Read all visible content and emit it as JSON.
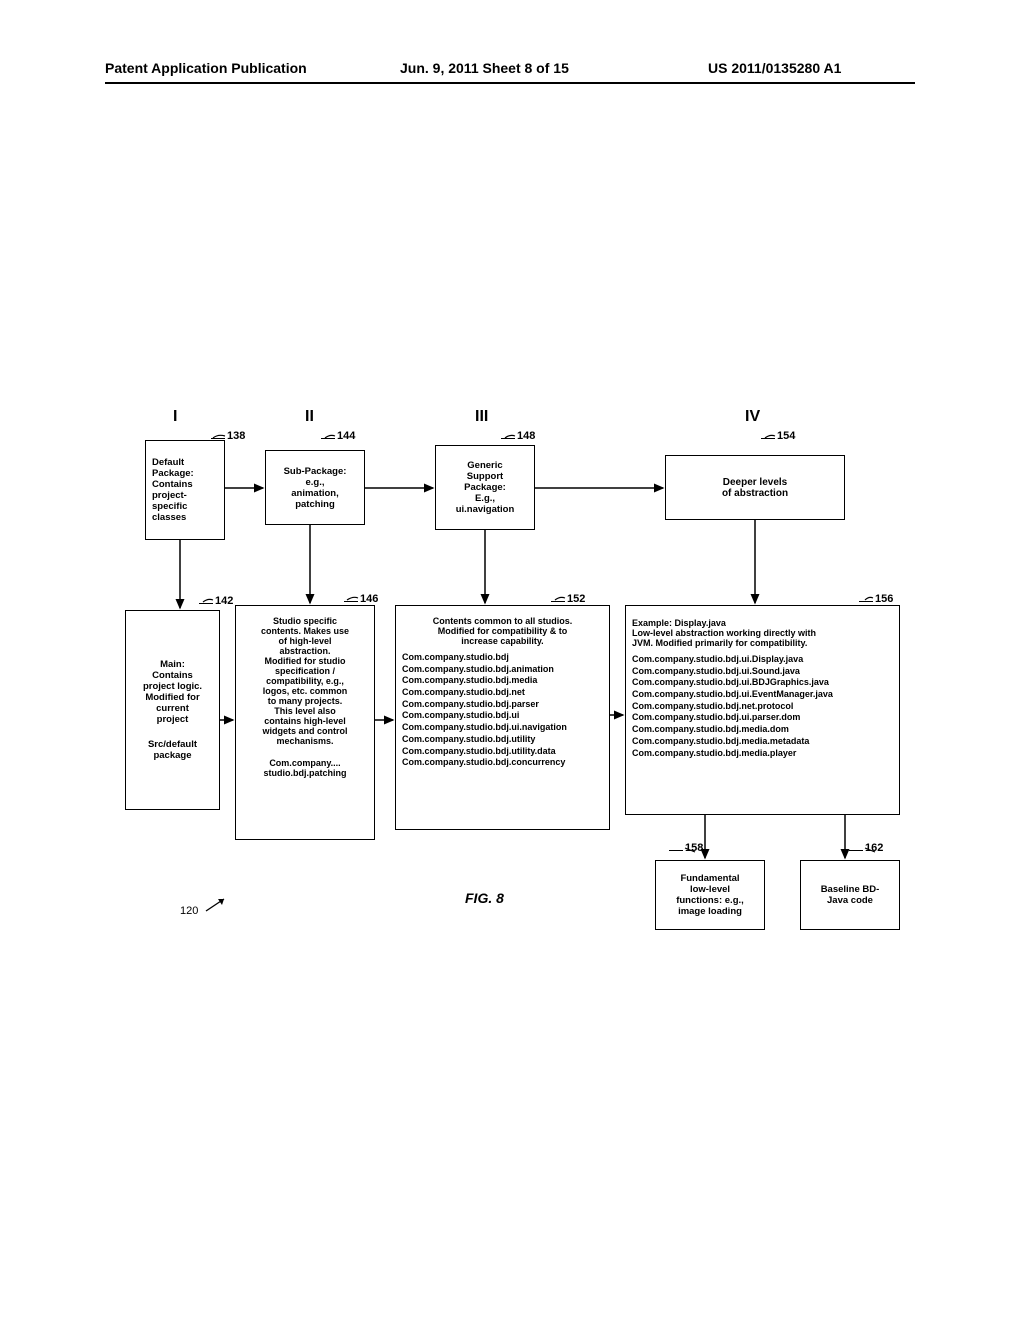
{
  "header": {
    "left": "Patent Application Publication",
    "mid": "Jun. 9, 2011  Sheet 8 of 15",
    "right": "US 2011/0135280 A1"
  },
  "columns": {
    "c1": "I",
    "c2": "II",
    "c3": "III",
    "c4": "IV"
  },
  "callouts": {
    "b138": "138",
    "b144": "144",
    "b148": "148",
    "b154": "154",
    "b142": "142",
    "b146": "146",
    "b152": "152",
    "b156": "156",
    "b158": "158",
    "b162": "162"
  },
  "boxes": {
    "b138": "Default\nPackage:\nContains\nproject-\nspecific\nclasses",
    "b144": "Sub-Package:\ne.g.,\nanimation,\npatching",
    "b148": "Generic\nSupport\nPackage:\nE.g.,\nui.navigation",
    "b154": "Deeper levels\nof abstraction",
    "b142_top": "Main:\nContains\nproject logic.\nModified for\ncurrent\nproject",
    "b142_bot": "Src/default\npackage",
    "b146_top": "Studio specific\ncontents.  Makes use\nof high-level\nabstraction.\nModified for studio\nspecification /\ncompatibility, e.g.,\nlogos, etc. common\nto many projects.\nThis level also\ncontains high-level\nwidgets and control\nmechanisms.",
    "b146_bot": "Com.company....\nstudio.bdj.patching",
    "b152_top": "Contents common to all studios.\nModified for compatibility & to\nincrease capability.",
    "b152_list": "Com.company.studio.bdj\nCom.company.studio.bdj.animation\nCom.company.studio.bdj.media\nCom.company.studio.bdj.net\nCom.company.studio.bdj.parser\nCom.company.studio.bdj.ui\nCom.company.studio.bdj.ui.navigation\nCom.company.studio.bdj.utility\nCom.company.studio.bdj.utility.data\nCom.company.studio.bdj.concurrency",
    "b156_top": "Example: Display.java\nLow-level abstraction working directly with\nJVM. Modified primarily for compatibility.",
    "b156_list": "Com.company.studio.bdj.ui.Display.java\nCom.company.studio.bdj.ui.Sound.java\nCom.company.studio.bdj.ui.BDJGraphics.java\nCom.company.studio.bdj.ui.EventManager.java\nCom.company.studio.bdj.net.protocol\nCom.company.studio.bdj.ui.parser.dom\nCom.company.studio.bdj.media.dom\nCom.company.studio.bdj.media.metadata\nCom.company.studio.bdj.media.player",
    "b158": "Fundamental\nlow-level\nfunctions: e.g.,\nimage loading",
    "b162": "Baseline BD-\nJava code"
  },
  "figureLabel": "FIG. 8",
  "diagramRef": "120"
}
